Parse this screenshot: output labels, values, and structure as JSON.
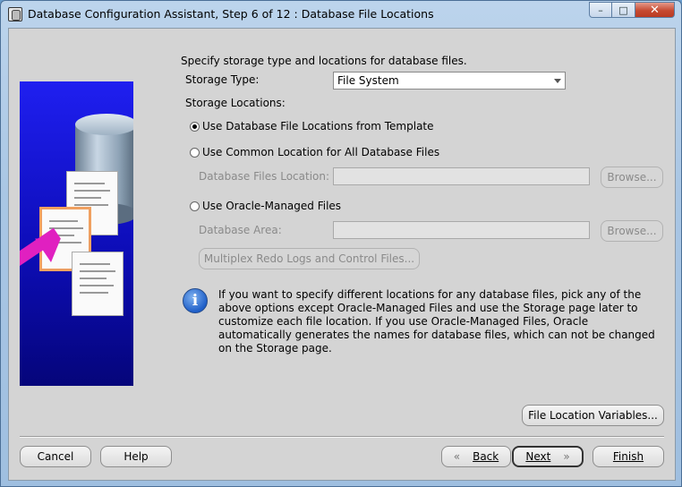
{
  "window": {
    "title": "Database Configuration Assistant, Step 6 of 12 : Database File Locations"
  },
  "intro": "Specify storage type and locations for database files.",
  "storage_type": {
    "label": "Storage Type:",
    "value": "File System"
  },
  "storage_locations_label": "Storage Locations:",
  "options": {
    "template": "Use Database File Locations from Template",
    "common": "Use Common Location for All Database Files",
    "files_location_label": "Database Files Location:",
    "omf": "Use Oracle-Managed Files",
    "area_label": "Database Area:",
    "browse": "Browse...",
    "multiplex": "Multiplex Redo Logs and Control Files..."
  },
  "info": "If you want to specify different locations for any database files, pick any of the above options except Oracle-Managed Files and use the Storage page later to customize each file location. If you use Oracle-Managed Files, Oracle automatically generates the names for database files, which can not be changed on the Storage page.",
  "buttons": {
    "file_location_variables": "File Location Variables...",
    "cancel": "Cancel",
    "help": "Help",
    "back": "Back",
    "next": "Next",
    "finish": "Finish"
  }
}
